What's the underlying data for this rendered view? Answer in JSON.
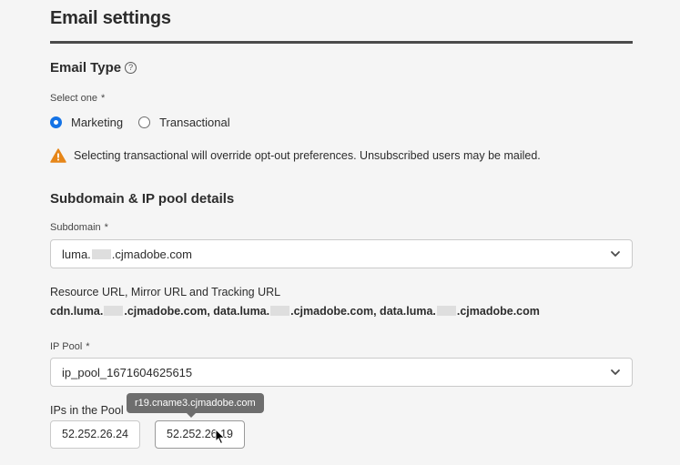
{
  "header": {
    "title": "Email settings"
  },
  "email_type": {
    "heading": "Email Type",
    "help_glyph": "?",
    "select_label": "Select one",
    "required_marker": "*",
    "options": [
      {
        "label": "Marketing",
        "selected": true
      },
      {
        "label": "Transactional",
        "selected": false
      }
    ],
    "warning_text": "Selecting transactional will override opt-out preferences. Unsubscribed users may be mailed.",
    "warning_icon": "alert-triangle-icon",
    "warning_color": "#e68619",
    "radio_accent": "#1473e6"
  },
  "subdomain": {
    "heading": "Subdomain & IP pool details",
    "label": "Subdomain",
    "required_marker": "*",
    "value_prefix": "luma.",
    "value_suffix": ".cjmadobe.com"
  },
  "urls": {
    "label": "Resource URL, Mirror URL and Tracking URL",
    "parts": [
      "cdn.luma.",
      ".cjmadobe.com, data.luma.",
      ".cjmadobe.com, data.luma.",
      ".cjmadobe.com"
    ]
  },
  "ip_pool": {
    "label": "IP Pool",
    "required_marker": "*",
    "value": "ip_pool_1671604625615"
  },
  "ips": {
    "label": "IPs in the Pool",
    "items": [
      "52.252.26.24",
      "52.252.26.19"
    ],
    "tooltip": "r19.cname3.cjmadobe.com"
  }
}
